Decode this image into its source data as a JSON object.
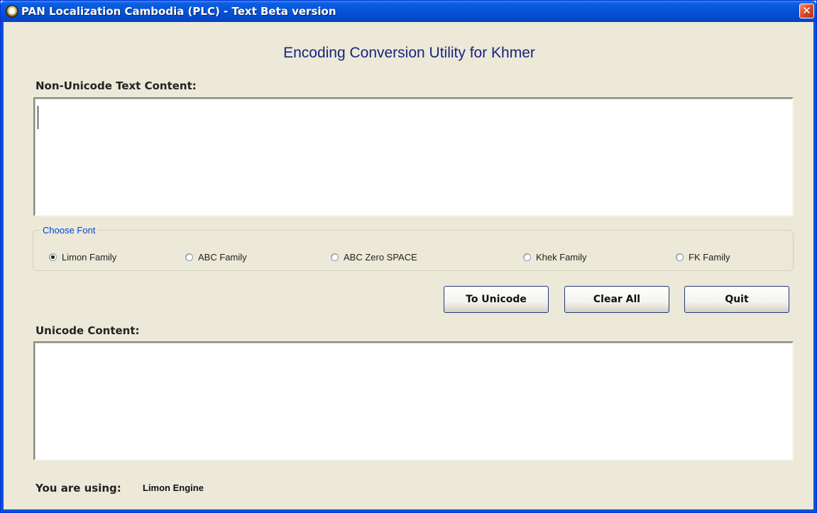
{
  "window": {
    "title": "PAN Localization Cambodia (PLC) - Text Beta version",
    "close_glyph": "✕"
  },
  "main": {
    "heading": "Encoding Conversion Utility for Khmer",
    "input_label": "Non-Unicode Text Content:",
    "input_value": "",
    "output_label": "Unicode Content:",
    "output_value": ""
  },
  "font_group": {
    "legend": "Choose Font",
    "options": [
      {
        "label": "Limon Family",
        "selected": true
      },
      {
        "label": "ABC Family",
        "selected": false
      },
      {
        "label": "ABC Zero SPACE",
        "selected": false
      },
      {
        "label": "Khek Family",
        "selected": false
      },
      {
        "label": "FK Family",
        "selected": false
      }
    ]
  },
  "buttons": {
    "to_unicode": "To Unicode",
    "clear_all": "Clear All",
    "quit": "Quit"
  },
  "status": {
    "label": "You are using:",
    "value": "Limon Engine"
  },
  "colors": {
    "titlebar": "#0553d8",
    "heading": "#1a237e",
    "legend": "#0046d5",
    "window_bg": "#ece9d8"
  }
}
